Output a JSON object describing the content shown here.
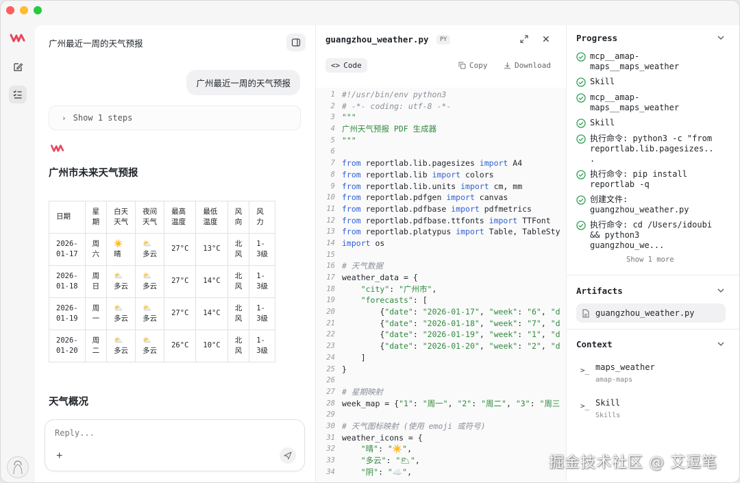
{
  "chat": {
    "title": "广州最近一周的天气预报",
    "user_message": "广州最近一周的天气预报",
    "steps_label": "Show 1 steps",
    "forecast_heading": "广州市未来天气预报",
    "table": {
      "headers": [
        "日期",
        "星期",
        "白天天气",
        "夜间天气",
        "最高温度",
        "最低温度",
        "风向",
        "风力"
      ],
      "header_lines": [
        [
          "日期"
        ],
        [
          "星",
          "期"
        ],
        [
          "白天",
          "天气"
        ],
        [
          "夜间",
          "天气"
        ],
        [
          "最高",
          "温度"
        ],
        [
          "最低",
          "温度"
        ],
        [
          "风",
          "向"
        ],
        [
          "风",
          "力"
        ]
      ],
      "rows": [
        {
          "date": [
            "2026-",
            "01-17"
          ],
          "week": [
            "周",
            "六"
          ],
          "day_icon": "☀️",
          "day": "晴",
          "night_icon": "⛅",
          "night": "多云",
          "high": "27°C",
          "low": "13°C",
          "dir": [
            "北",
            "风"
          ],
          "power": [
            "1-",
            "3级"
          ]
        },
        {
          "date": [
            "2026-",
            "01-18"
          ],
          "week": [
            "周",
            "日"
          ],
          "day_icon": "⛅",
          "day": "多云",
          "night_icon": "⛅",
          "night": "多云",
          "high": "27°C",
          "low": "14°C",
          "dir": [
            "北",
            "风"
          ],
          "power": [
            "1-",
            "3级"
          ]
        },
        {
          "date": [
            "2026-",
            "01-19"
          ],
          "week": [
            "周",
            "一"
          ],
          "day_icon": "⛅",
          "day": "多云",
          "night_icon": "⛅",
          "night": "多云",
          "high": "27°C",
          "low": "14°C",
          "dir": [
            "北",
            "风"
          ],
          "power": [
            "1-",
            "3级"
          ]
        },
        {
          "date": [
            "2026-",
            "01-20"
          ],
          "week": [
            "周",
            "二"
          ],
          "day_icon": "⛅",
          "day": "多云",
          "night_icon": "⛅",
          "night": "多云",
          "high": "26°C",
          "low": "10°C",
          "dir": [
            "北",
            "风"
          ],
          "power": [
            "1-",
            "3级"
          ]
        }
      ]
    },
    "overview_heading": "天气概况",
    "composer_placeholder": "Reply..."
  },
  "code_pane": {
    "file_name": "guangzhou_weather.py",
    "badge": "PY",
    "tab_label": "Code",
    "copy_label": "Copy",
    "download_label": "Download",
    "lines": [
      [
        [
          "cm",
          "#!/usr/bin/env python3"
        ]
      ],
      [
        [
          "cm",
          "# -*- coding: utf-8 -*-"
        ]
      ],
      [
        [
          "st",
          "\"\"\""
        ]
      ],
      [
        [
          "st",
          "广州天气预报 PDF 生成器"
        ]
      ],
      [
        [
          "st",
          "\"\"\""
        ]
      ],
      [],
      [
        [
          "kw",
          "from"
        ],
        [
          "pl",
          " reportlab.lib.pagesizes "
        ],
        [
          "kw",
          "import"
        ],
        [
          "pl",
          " A4"
        ]
      ],
      [
        [
          "kw",
          "from"
        ],
        [
          "pl",
          " reportlab.lib "
        ],
        [
          "kw",
          "import"
        ],
        [
          "pl",
          " colors"
        ]
      ],
      [
        [
          "kw",
          "from"
        ],
        [
          "pl",
          " reportlab.lib.units "
        ],
        [
          "kw",
          "import"
        ],
        [
          "pl",
          " cm, mm"
        ]
      ],
      [
        [
          "kw",
          "from"
        ],
        [
          "pl",
          " reportlab.pdfgen "
        ],
        [
          "kw",
          "import"
        ],
        [
          "pl",
          " canvas"
        ]
      ],
      [
        [
          "kw",
          "from"
        ],
        [
          "pl",
          " reportlab.pdfbase "
        ],
        [
          "kw",
          "import"
        ],
        [
          "pl",
          " pdfmetrics"
        ]
      ],
      [
        [
          "kw",
          "from"
        ],
        [
          "pl",
          " reportlab.pdfbase.ttfonts "
        ],
        [
          "kw",
          "import"
        ],
        [
          "pl",
          " TTFont"
        ]
      ],
      [
        [
          "kw",
          "from"
        ],
        [
          "pl",
          " reportlab.platypus "
        ],
        [
          "kw",
          "import"
        ],
        [
          "pl",
          " Table, TableSty"
        ]
      ],
      [
        [
          "kw",
          "import"
        ],
        [
          "pl",
          " os"
        ]
      ],
      [],
      [
        [
          "cm",
          "# 天气数据"
        ]
      ],
      [
        [
          "pl",
          "weather_data = {"
        ]
      ],
      [
        [
          "pl",
          "    "
        ],
        [
          "st",
          "\"city\""
        ],
        [
          "pl",
          ": "
        ],
        [
          "st",
          "\"广州市\""
        ],
        [
          "pl",
          ","
        ]
      ],
      [
        [
          "pl",
          "    "
        ],
        [
          "st",
          "\"forecasts\""
        ],
        [
          "pl",
          ": ["
        ]
      ],
      [
        [
          "pl",
          "        {"
        ],
        [
          "st",
          "\"date\""
        ],
        [
          "pl",
          ": "
        ],
        [
          "st",
          "\"2026-01-17\""
        ],
        [
          "pl",
          ", "
        ],
        [
          "st",
          "\"week\""
        ],
        [
          "pl",
          ": "
        ],
        [
          "st",
          "\"6\""
        ],
        [
          "pl",
          ", "
        ],
        [
          "st",
          "\"d"
        ]
      ],
      [
        [
          "pl",
          "        {"
        ],
        [
          "st",
          "\"date\""
        ],
        [
          "pl",
          ": "
        ],
        [
          "st",
          "\"2026-01-18\""
        ],
        [
          "pl",
          ", "
        ],
        [
          "st",
          "\"week\""
        ],
        [
          "pl",
          ": "
        ],
        [
          "st",
          "\"7\""
        ],
        [
          "pl",
          ", "
        ],
        [
          "st",
          "\"d"
        ]
      ],
      [
        [
          "pl",
          "        {"
        ],
        [
          "st",
          "\"date\""
        ],
        [
          "pl",
          ": "
        ],
        [
          "st",
          "\"2026-01-19\""
        ],
        [
          "pl",
          ", "
        ],
        [
          "st",
          "\"week\""
        ],
        [
          "pl",
          ": "
        ],
        [
          "st",
          "\"1\""
        ],
        [
          "pl",
          ", "
        ],
        [
          "st",
          "\"d"
        ]
      ],
      [
        [
          "pl",
          "        {"
        ],
        [
          "st",
          "\"date\""
        ],
        [
          "pl",
          ": "
        ],
        [
          "st",
          "\"2026-01-20\""
        ],
        [
          "pl",
          ", "
        ],
        [
          "st",
          "\"week\""
        ],
        [
          "pl",
          ": "
        ],
        [
          "st",
          "\"2\""
        ],
        [
          "pl",
          ", "
        ],
        [
          "st",
          "\"d"
        ]
      ],
      [
        [
          "pl",
          "    ]"
        ]
      ],
      [
        [
          "pl",
          "}"
        ]
      ],
      [],
      [
        [
          "cm",
          "# 星期映射"
        ]
      ],
      [
        [
          "pl",
          "week_map = {"
        ],
        [
          "st",
          "\"1\""
        ],
        [
          "pl",
          ": "
        ],
        [
          "st",
          "\"周一\""
        ],
        [
          "pl",
          ", "
        ],
        [
          "st",
          "\"2\""
        ],
        [
          "pl",
          ": "
        ],
        [
          "st",
          "\"周二\""
        ],
        [
          "pl",
          ", "
        ],
        [
          "st",
          "\"3\""
        ],
        [
          "pl",
          ": "
        ],
        [
          "st",
          "\"周三"
        ]
      ],
      [],
      [
        [
          "cm",
          "# 天气图标映射 (使用 emoji 或符号)"
        ]
      ],
      [
        [
          "pl",
          "weather_icons = {"
        ]
      ],
      [
        [
          "pl",
          "    "
        ],
        [
          "st",
          "\"晴\""
        ],
        [
          "pl",
          ": "
        ],
        [
          "st",
          "\"☀️\""
        ],
        [
          "pl",
          ","
        ]
      ],
      [
        [
          "pl",
          "    "
        ],
        [
          "st",
          "\"多云\""
        ],
        [
          "pl",
          ": "
        ],
        [
          "st",
          "\"🌥\""
        ],
        [
          "pl",
          ","
        ]
      ],
      [
        [
          "pl",
          "    "
        ],
        [
          "st",
          "\"阴\""
        ],
        [
          "pl",
          ": "
        ],
        [
          "st",
          "\"☁️\""
        ],
        [
          "pl",
          ","
        ]
      ]
    ]
  },
  "right_panel": {
    "progress_title": "Progress",
    "progress_items": [
      {
        "lines": [
          "mcp__amap-",
          "maps__maps_weather"
        ]
      },
      {
        "lines": [
          "Skill"
        ]
      },
      {
        "lines": [
          "mcp__amap-",
          "maps__maps_weather"
        ]
      },
      {
        "lines": [
          "Skill"
        ]
      },
      {
        "lines": [
          "执行命令: python3 -c \"from",
          "reportlab.lib.pagesizes..",
          "."
        ]
      },
      {
        "lines": [
          "执行命令: pip install",
          "reportlab -q"
        ]
      },
      {
        "lines": [
          "创建文件:",
          "guangzhou_weather.py"
        ]
      },
      {
        "lines": [
          "执行命令: cd /Users/idoubi",
          "&& python3",
          "guangzhou_we..."
        ]
      }
    ],
    "show_more": "Show 1 more",
    "artifacts_title": "Artifacts",
    "artifact_name": "guangzhou_weather.py",
    "context_title": "Context",
    "context_items": [
      {
        "name": "maps_weather",
        "sub": "amap-maps"
      },
      {
        "name": "Skill",
        "sub": "Skills"
      }
    ]
  },
  "watermark": "掘金技术社区 @ 艾逗笔",
  "colors": {
    "accent": "#e8475d",
    "check": "#2f9e55",
    "keyword": "#2f5fd0",
    "string": "#2f8a3b",
    "comment": "#8a8f99"
  }
}
